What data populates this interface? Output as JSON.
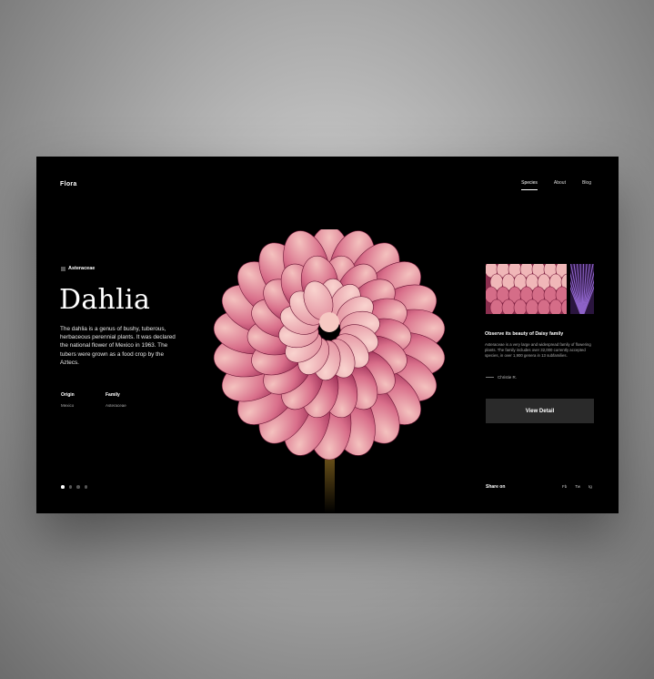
{
  "app": {
    "logo": "Flora"
  },
  "nav": {
    "items": [
      "Species",
      "About",
      "Blog"
    ],
    "active": "Species"
  },
  "hero": {
    "family_tag": "Asteraceae",
    "title": "Dahlia",
    "description": "The dahlia is a genus of bushy, tuberous, herbaceous perennial plants. It was declared the national flower of Mexico in 1963. The tubers were grown as a food crop by the Aztecs.",
    "origin_label": "Origin",
    "origin_value": "Mexico",
    "family_label": "Family",
    "family_value": "Asteraceae"
  },
  "carousel": {
    "slides": 4,
    "active_index": 0
  },
  "side": {
    "title": "Observe its beauty of Daisy family",
    "description": "Asteraceae is a very large and widespread family of flowering plants. The family includes over 32,000 currently accepted species, in over 1,900 genera in 13 subfamilies.",
    "author": "Christie R.",
    "button_label": "View Detail"
  },
  "share": {
    "label": "Share on",
    "items": [
      "Fb",
      "Tw",
      "Ig"
    ]
  },
  "colors": {
    "background": "#000000",
    "petal_dark": "#a02a55",
    "petal_light": "#f1b2b4",
    "stem": "#b58a2a",
    "button_bg": "#2a2a2a"
  }
}
